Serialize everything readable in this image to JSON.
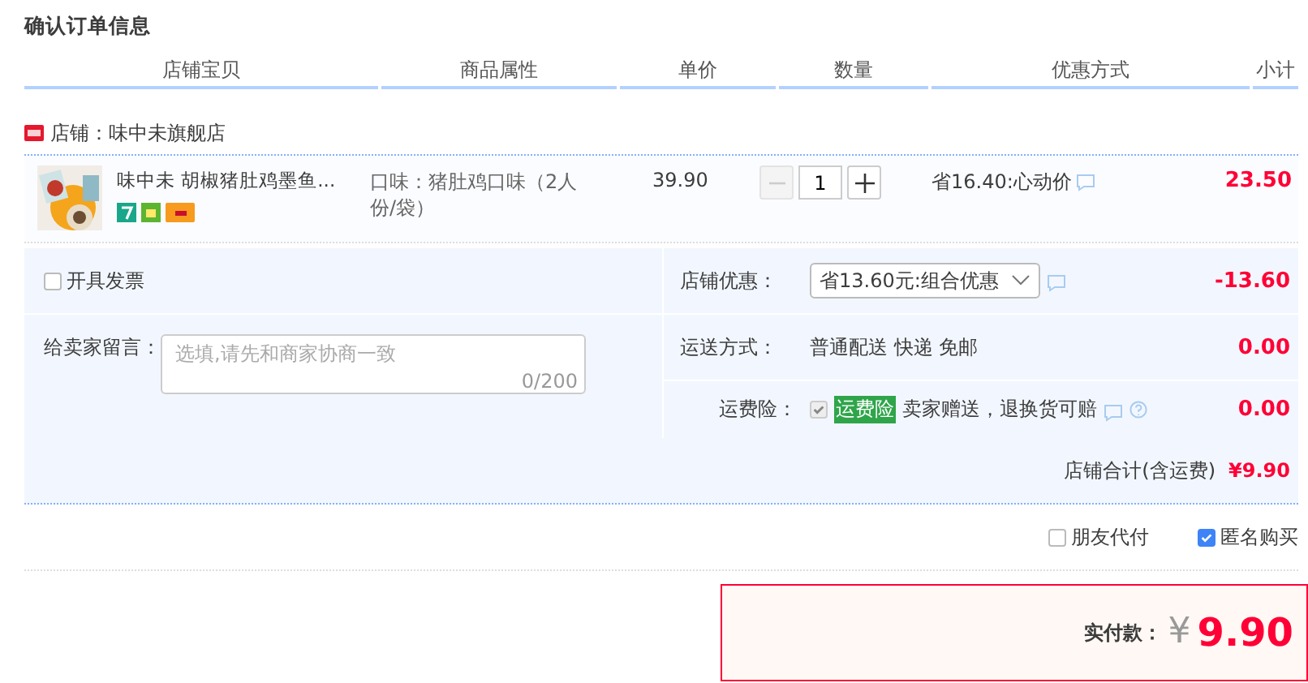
{
  "title": "确认订单信息",
  "columns": [
    "店铺宝贝",
    "商品属性",
    "单价",
    "数量",
    "优惠方式",
    "小计"
  ],
  "shop": {
    "label": "店铺：味中未旗舰店"
  },
  "item": {
    "name": "味中未 胡椒猪肚鸡墨鱼...",
    "attribute": "口味：猪肚鸡口味（2人份/袋）",
    "price": "39.90",
    "quantity": "1",
    "minus": {
      "disabled": true
    },
    "promo": "省16.40:心动价",
    "subtotal": "23.50"
  },
  "invoice": {
    "label": "开具发票",
    "checked": false
  },
  "message": {
    "label": "给卖家留言：",
    "placeholder": "选填,请先和商家协商一致",
    "counter": "0/200"
  },
  "options": [
    {
      "kind": "select",
      "label": "店铺优惠：",
      "value": "省13.60元:组合优惠",
      "amount": "-13.60"
    },
    {
      "kind": "text",
      "label": "运送方式：",
      "value": "普通配送 快递 免邮",
      "amount": "0.00"
    },
    {
      "kind": "insurance",
      "label": "运费险：",
      "checked": true,
      "tag": "运费险",
      "value": "卖家赠送，退换货可赔",
      "amount": "0.00"
    }
  ],
  "store_total": {
    "label": "店铺合计(含运费)",
    "value": "¥9.90"
  },
  "checks": [
    {
      "label": "朋友代付",
      "checked": false
    },
    {
      "label": "匿名购买",
      "checked": true
    }
  ],
  "pay": {
    "label": "实付款：",
    "currency": "¥",
    "value": "9.90"
  }
}
